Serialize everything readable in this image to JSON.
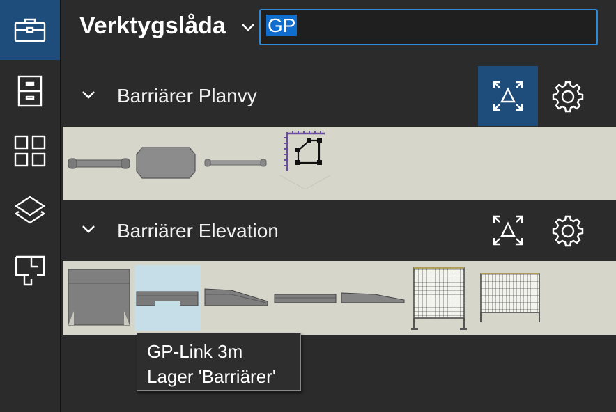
{
  "rail": {
    "items": [
      {
        "name": "toolbox-icon",
        "active": true
      },
      {
        "name": "cabinet-icon",
        "active": false
      },
      {
        "name": "grid-icon",
        "active": false
      },
      {
        "name": "layers-icon",
        "active": false
      },
      {
        "name": "floorplan-icon",
        "active": false
      }
    ]
  },
  "header": {
    "title": "Verktygslåda",
    "search_value": "GP"
  },
  "sections": [
    {
      "label": "Barriärer Planvy",
      "actions": [
        "fit-view-icon",
        "settings-icon"
      ],
      "fit_active": true
    },
    {
      "label": "Barriärer Elevation",
      "actions": [
        "fit-view-icon",
        "settings-icon"
      ],
      "fit_active": false
    }
  ],
  "tooltip": {
    "line1": "GP-Link 3m",
    "line2": "Lager 'Barriärer'"
  },
  "colors": {
    "rail_active": "#1e4d7b",
    "search_border": "#2e8ad8",
    "selection": "#0f6dce",
    "tray_bg": "#d7d6cb",
    "hover_item": "#c6dee8",
    "accent_purple": "#6a4ca3"
  }
}
